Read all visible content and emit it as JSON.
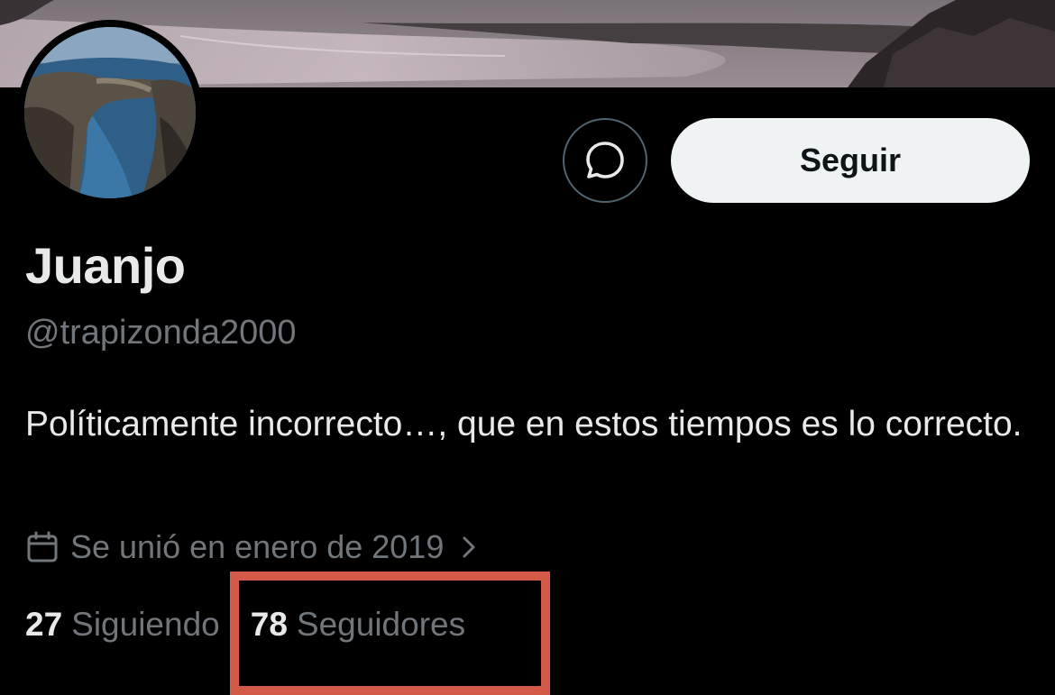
{
  "profile": {
    "name": "Juanjo",
    "handle": "@trapizonda2000",
    "bio": "Políticamente incorrecto…, que en estos tiempos es lo correcto.",
    "joined": "Se unió en enero de 2019"
  },
  "actions": {
    "follow_label": "Seguir",
    "message_icon": "message-bubble-icon"
  },
  "stats": {
    "following_count": "27",
    "following_label": "Siguiendo",
    "followers_count": "78",
    "followers_label": "Seguidores"
  },
  "colors": {
    "background": "#000000",
    "primary_text": "#e7e9ea",
    "secondary_text": "#71767b",
    "follow_button_bg": "#eff3f4",
    "highlight_border": "#d35a47"
  },
  "icons": {
    "calendar": "calendar-icon",
    "chevron": "chevron-right-icon"
  }
}
